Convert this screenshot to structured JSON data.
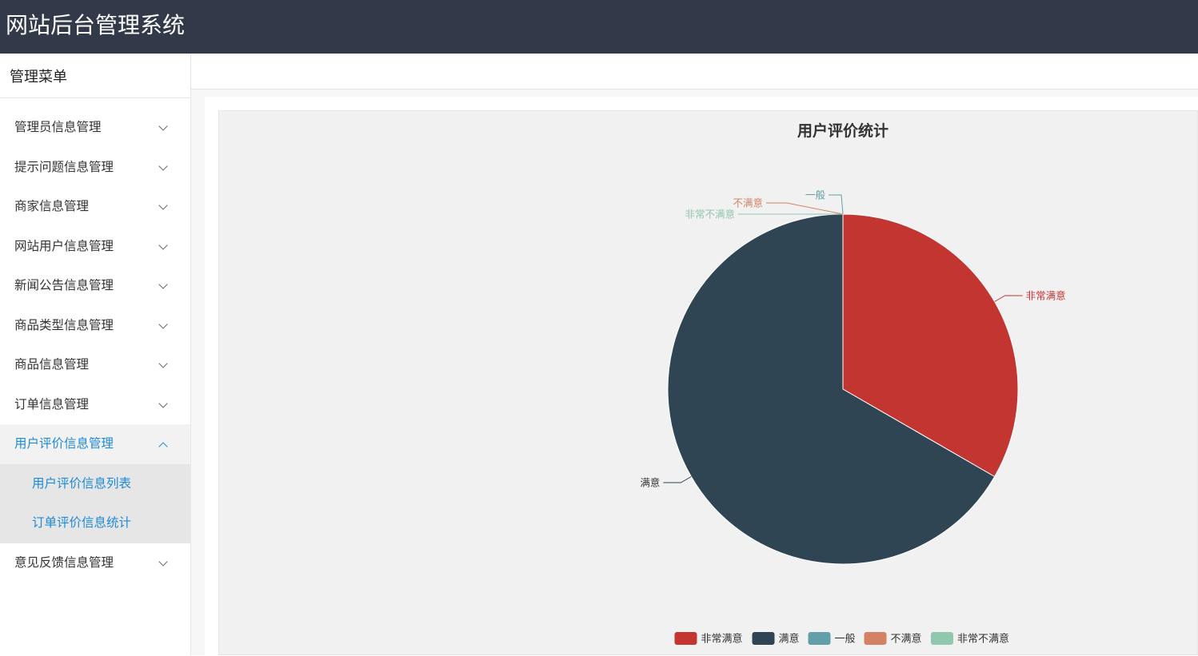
{
  "app": {
    "title": "网站后台管理系统"
  },
  "sidebar": {
    "heading": "管理菜单",
    "items": [
      {
        "label": "管理员信息管理"
      },
      {
        "label": "提示问题信息管理"
      },
      {
        "label": "商家信息管理"
      },
      {
        "label": "网站用户信息管理"
      },
      {
        "label": "新闻公告信息管理"
      },
      {
        "label": "商品类型信息管理"
      },
      {
        "label": "商品信息管理"
      },
      {
        "label": "订单信息管理"
      },
      {
        "label": "用户评价信息管理",
        "expanded": true,
        "children": [
          {
            "label": "用户评价信息列表"
          },
          {
            "label": "订单评价信息统计"
          }
        ]
      },
      {
        "label": "意见反馈信息管理"
      }
    ]
  },
  "icons": {
    "collapsed": "chevron-down-icon",
    "expanded": "chevron-up-icon"
  },
  "chart_data": {
    "type": "pie",
    "title": "用户评价统计",
    "categories": [
      "非常满意",
      "满意",
      "一般",
      "不满意",
      "非常不满意"
    ],
    "values": [
      1,
      2,
      0,
      0,
      0
    ],
    "colors": [
      "#c23531",
      "#2f4554",
      "#61a0a8",
      "#d48265",
      "#91c7ae"
    ],
    "legend_position": "bottom"
  }
}
